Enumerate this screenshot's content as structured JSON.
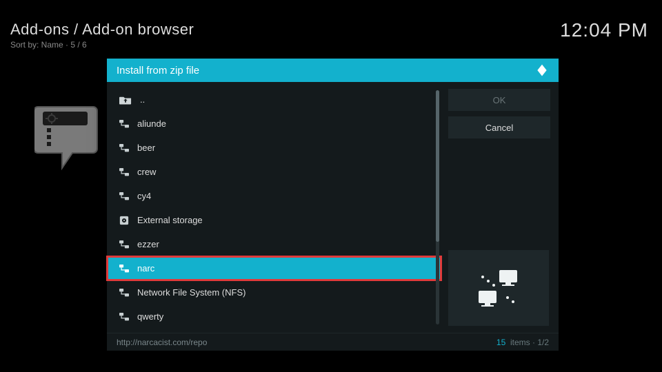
{
  "breadcrumb": {
    "title": "Add-ons / Add-on browser",
    "sub": "Sort by: Name  ·  5 / 6"
  },
  "clock": "12:04 PM",
  "dialog": {
    "title": "Install from zip file",
    "ok_label": "OK",
    "cancel_label": "Cancel",
    "footer_path": "http://narcacist.com/repo",
    "footer_count": "15",
    "footer_items_word": "items",
    "footer_page": "1/2"
  },
  "items": {
    "up": "..",
    "i0": "aliunde",
    "i1": "beer",
    "i2": "crew",
    "i3": "cy4",
    "i4": "External storage",
    "i5": "ezzer",
    "i6": "narc",
    "i7": "Network File System (NFS)",
    "i8": "qwerty"
  }
}
